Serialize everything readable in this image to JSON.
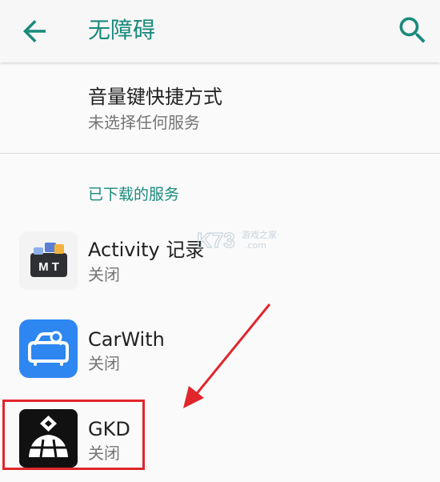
{
  "header": {
    "title": "无障碍"
  },
  "shortcut": {
    "title": "音量键快捷方式",
    "subtitle": "未选择任何服务"
  },
  "section_title": "已下载的服务",
  "services": [
    {
      "name": "Activity 记录",
      "status": "关闭",
      "icon": "mt-manager-icon"
    },
    {
      "name": "CarWith",
      "status": "关闭",
      "icon": "carwith-icon"
    },
    {
      "name": "GKD",
      "status": "关闭",
      "icon": "gkd-icon"
    }
  ],
  "watermark": {
    "logo": "K73",
    "text1": "游戏之家",
    "text2": ".com"
  },
  "colors": {
    "accent": "#1a8a7c",
    "annotation": "#e0262b"
  }
}
